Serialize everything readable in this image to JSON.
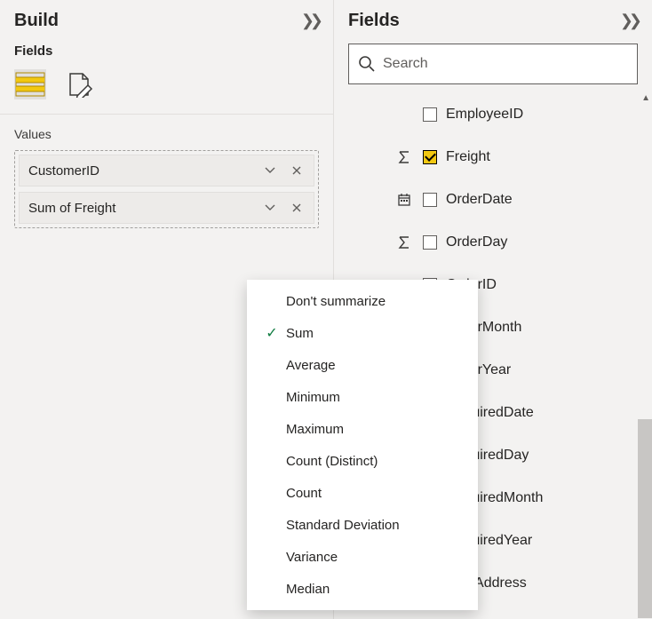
{
  "build": {
    "title": "Build",
    "fields_label": "Fields",
    "values_label": "Values",
    "wells": [
      {
        "label": "CustomerID"
      },
      {
        "label": "Sum of Freight"
      }
    ]
  },
  "context_menu": {
    "selected_index": 1,
    "items": [
      "Don't summarize",
      "Sum",
      "Average",
      "Minimum",
      "Maximum",
      "Count (Distinct)",
      "Count",
      "Standard Deviation",
      "Variance",
      "Median"
    ]
  },
  "fields_panel": {
    "title": "Fields",
    "search_placeholder": "Search",
    "items": [
      {
        "icon": "",
        "checked": false,
        "label": "EmployeeID"
      },
      {
        "icon": "sigma",
        "checked": true,
        "label": "Freight"
      },
      {
        "icon": "calendar",
        "checked": false,
        "label": "OrderDate"
      },
      {
        "icon": "sigma",
        "checked": false,
        "label": "OrderDay"
      },
      {
        "icon": "",
        "checked": false,
        "label": "OrderID"
      },
      {
        "icon": "",
        "checked": false,
        "label": "OrderMonth"
      },
      {
        "icon": "",
        "checked": false,
        "label": "OrderYear"
      },
      {
        "icon": "",
        "checked": false,
        "label": "RequiredDate"
      },
      {
        "icon": "",
        "checked": false,
        "label": "RequiredDay"
      },
      {
        "icon": "",
        "checked": false,
        "label": "RequiredMonth"
      },
      {
        "icon": "",
        "checked": false,
        "label": "RequiredYear"
      },
      {
        "icon": "",
        "checked": false,
        "label": "ShipAddress"
      }
    ]
  }
}
